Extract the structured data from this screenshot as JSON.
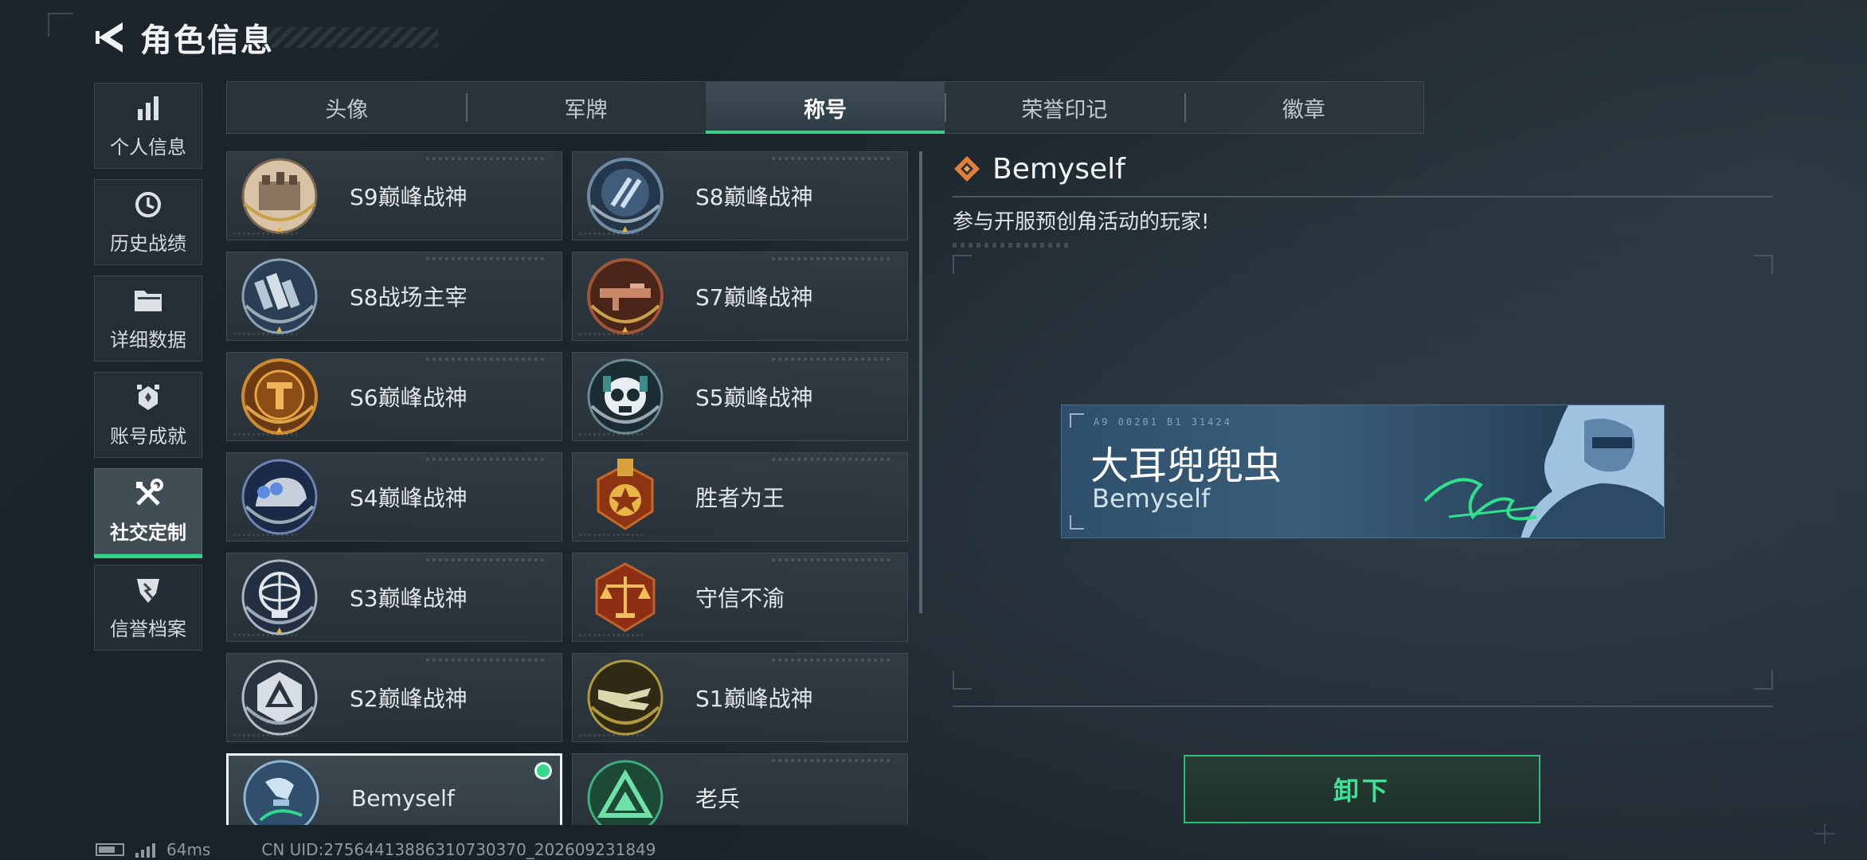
{
  "header": {
    "title": "角色信息"
  },
  "sidebar": {
    "items": [
      {
        "label": "个人信息",
        "icon": "bar-chart-icon",
        "active": false
      },
      {
        "label": "历史战绩",
        "icon": "history-clock-icon",
        "active": false
      },
      {
        "label": "详细数据",
        "icon": "folder-icon",
        "active": false
      },
      {
        "label": "账号成就",
        "icon": "achievement-icon",
        "active": false
      },
      {
        "label": "社交定制",
        "icon": "tools-icon",
        "active": true
      },
      {
        "label": "信誉档案",
        "icon": "credit-shield-icon",
        "active": false
      }
    ]
  },
  "tabs": [
    {
      "label": "头像",
      "active": false
    },
    {
      "label": "军牌",
      "active": false
    },
    {
      "label": "称号",
      "active": true
    },
    {
      "label": "荣誉印记",
      "active": false
    },
    {
      "label": "徽章",
      "active": false
    }
  ],
  "titles": [
    {
      "name": "S9巅峰战神",
      "icon": "fortress-badge-icon"
    },
    {
      "name": "S8巅峰战神",
      "icon": "slash-emblem-badge-icon"
    },
    {
      "name": "S8战场主宰",
      "icon": "city-badge-icon"
    },
    {
      "name": "S7巅峰战神",
      "icon": "rifle-badge-icon"
    },
    {
      "name": "S6巅峰战神",
      "icon": "t-shield-badge-icon"
    },
    {
      "name": "S5巅峰战神",
      "icon": "skull-badge-icon"
    },
    {
      "name": "S4巅峰战神",
      "icon": "helmet-badge-icon"
    },
    {
      "name": "胜者为王",
      "icon": "medal-badge-icon"
    },
    {
      "name": "S3巅峰战神",
      "icon": "globe-badge-icon"
    },
    {
      "name": "守信不渝",
      "icon": "scales-badge-icon"
    },
    {
      "name": "S2巅峰战神",
      "icon": "triangle-badge-icon"
    },
    {
      "name": "S1巅峰战神",
      "icon": "crocodile-badge-icon"
    },
    {
      "name": "Bemyself",
      "icon": "skater-badge-icon",
      "selected": true
    },
    {
      "name": "老兵",
      "icon": "veteran-triangle-badge-icon"
    }
  ],
  "detail": {
    "name": "Bemyself",
    "description": "参与开服预创角活动的玩家!",
    "banner": {
      "player_name": "大耳兜兜虫",
      "title": "Bemyself",
      "code": "A9 00201  B1 31424"
    },
    "action_label": "卸下"
  },
  "status": {
    "ping": "64ms",
    "uid": "CN UID:27564413886310730370_202609231849"
  },
  "colors": {
    "accent": "#35d18a",
    "panel": "#2e3a42",
    "text": "#e6e9ec"
  }
}
